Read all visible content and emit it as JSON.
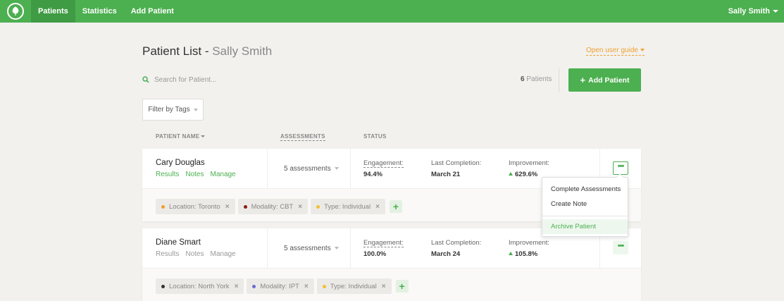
{
  "nav": {
    "items": [
      {
        "label": "Patients",
        "active": true
      },
      {
        "label": "Statistics"
      },
      {
        "label": "Add Patient"
      }
    ],
    "user": "Sally Smith"
  },
  "header": {
    "title": "Patient List - ",
    "subtitle": "Sally Smith",
    "guide_link": "Open user guide"
  },
  "search": {
    "placeholder": "Search for Patient..."
  },
  "patient_count": {
    "number": "6",
    "label": "Patients"
  },
  "add_button": {
    "label": "Add Patient"
  },
  "filter": {
    "label": "Filter by Tags"
  },
  "columns": {
    "name": "PATIENT NAME",
    "assessments": "ASSESSMENTS",
    "status": "STATUS"
  },
  "colors": {
    "accent": "#4caf50",
    "link_orange": "#f0a030"
  },
  "patients": [
    {
      "name": "Cary Douglas",
      "links": [
        "Results",
        "Notes",
        "Manage"
      ],
      "links_active": true,
      "assessments": "5 assessments",
      "engagement_label": "Engagement:",
      "engagement": "94.4%",
      "last_label": "Last Completion:",
      "last": "March 21",
      "improvement_label": "Improvement:",
      "improvement": "629.6%",
      "tags": [
        {
          "label": "Location: Toronto",
          "color": "#f0a030"
        },
        {
          "label": "Modality: CBT",
          "color": "#8b1a1a"
        },
        {
          "label": "Type: Individual",
          "color": "#f0c030"
        }
      ]
    },
    {
      "name": "Diane Smart",
      "links": [
        "Results",
        "Notes",
        "Manage"
      ],
      "links_active": false,
      "assessments": "5 assessments",
      "engagement_label": "Engagement:",
      "engagement": "100.0%",
      "last_label": "Last Completion:",
      "last": "March 24",
      "improvement_label": "Improvement:",
      "improvement": "105.8%",
      "tags": [
        {
          "label": "Location: North York",
          "color": "#333333"
        },
        {
          "label": "Modality: IPT",
          "color": "#6b6bd6"
        },
        {
          "label": "Type: Individual",
          "color": "#f0c030"
        }
      ]
    }
  ],
  "menu": {
    "items": [
      "Complete Assessments",
      "Create Note",
      "Archive Patient"
    ]
  }
}
